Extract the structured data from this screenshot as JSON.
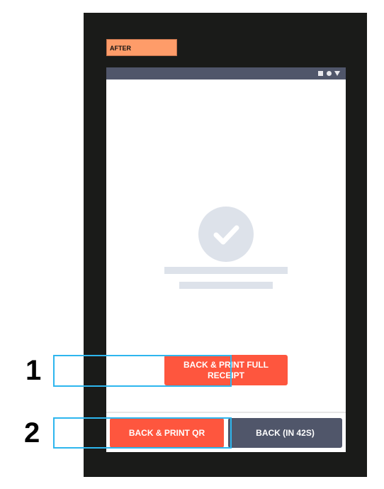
{
  "label": "AFTER",
  "status_icons": [
    "square-icon",
    "circle-icon",
    "triangle-down-icon"
  ],
  "buttons": {
    "full_receipt": "BACK & PRINT FULL RECEIPT",
    "print_qr": "BACK & PRINT QR",
    "back": "BACK (IN 42S)"
  },
  "annotations": [
    "1",
    "2"
  ],
  "colors": {
    "accent": "#fe563e",
    "secondary": "#50566a",
    "label": "#fe9c69",
    "highlight": "#2eb6ee"
  }
}
